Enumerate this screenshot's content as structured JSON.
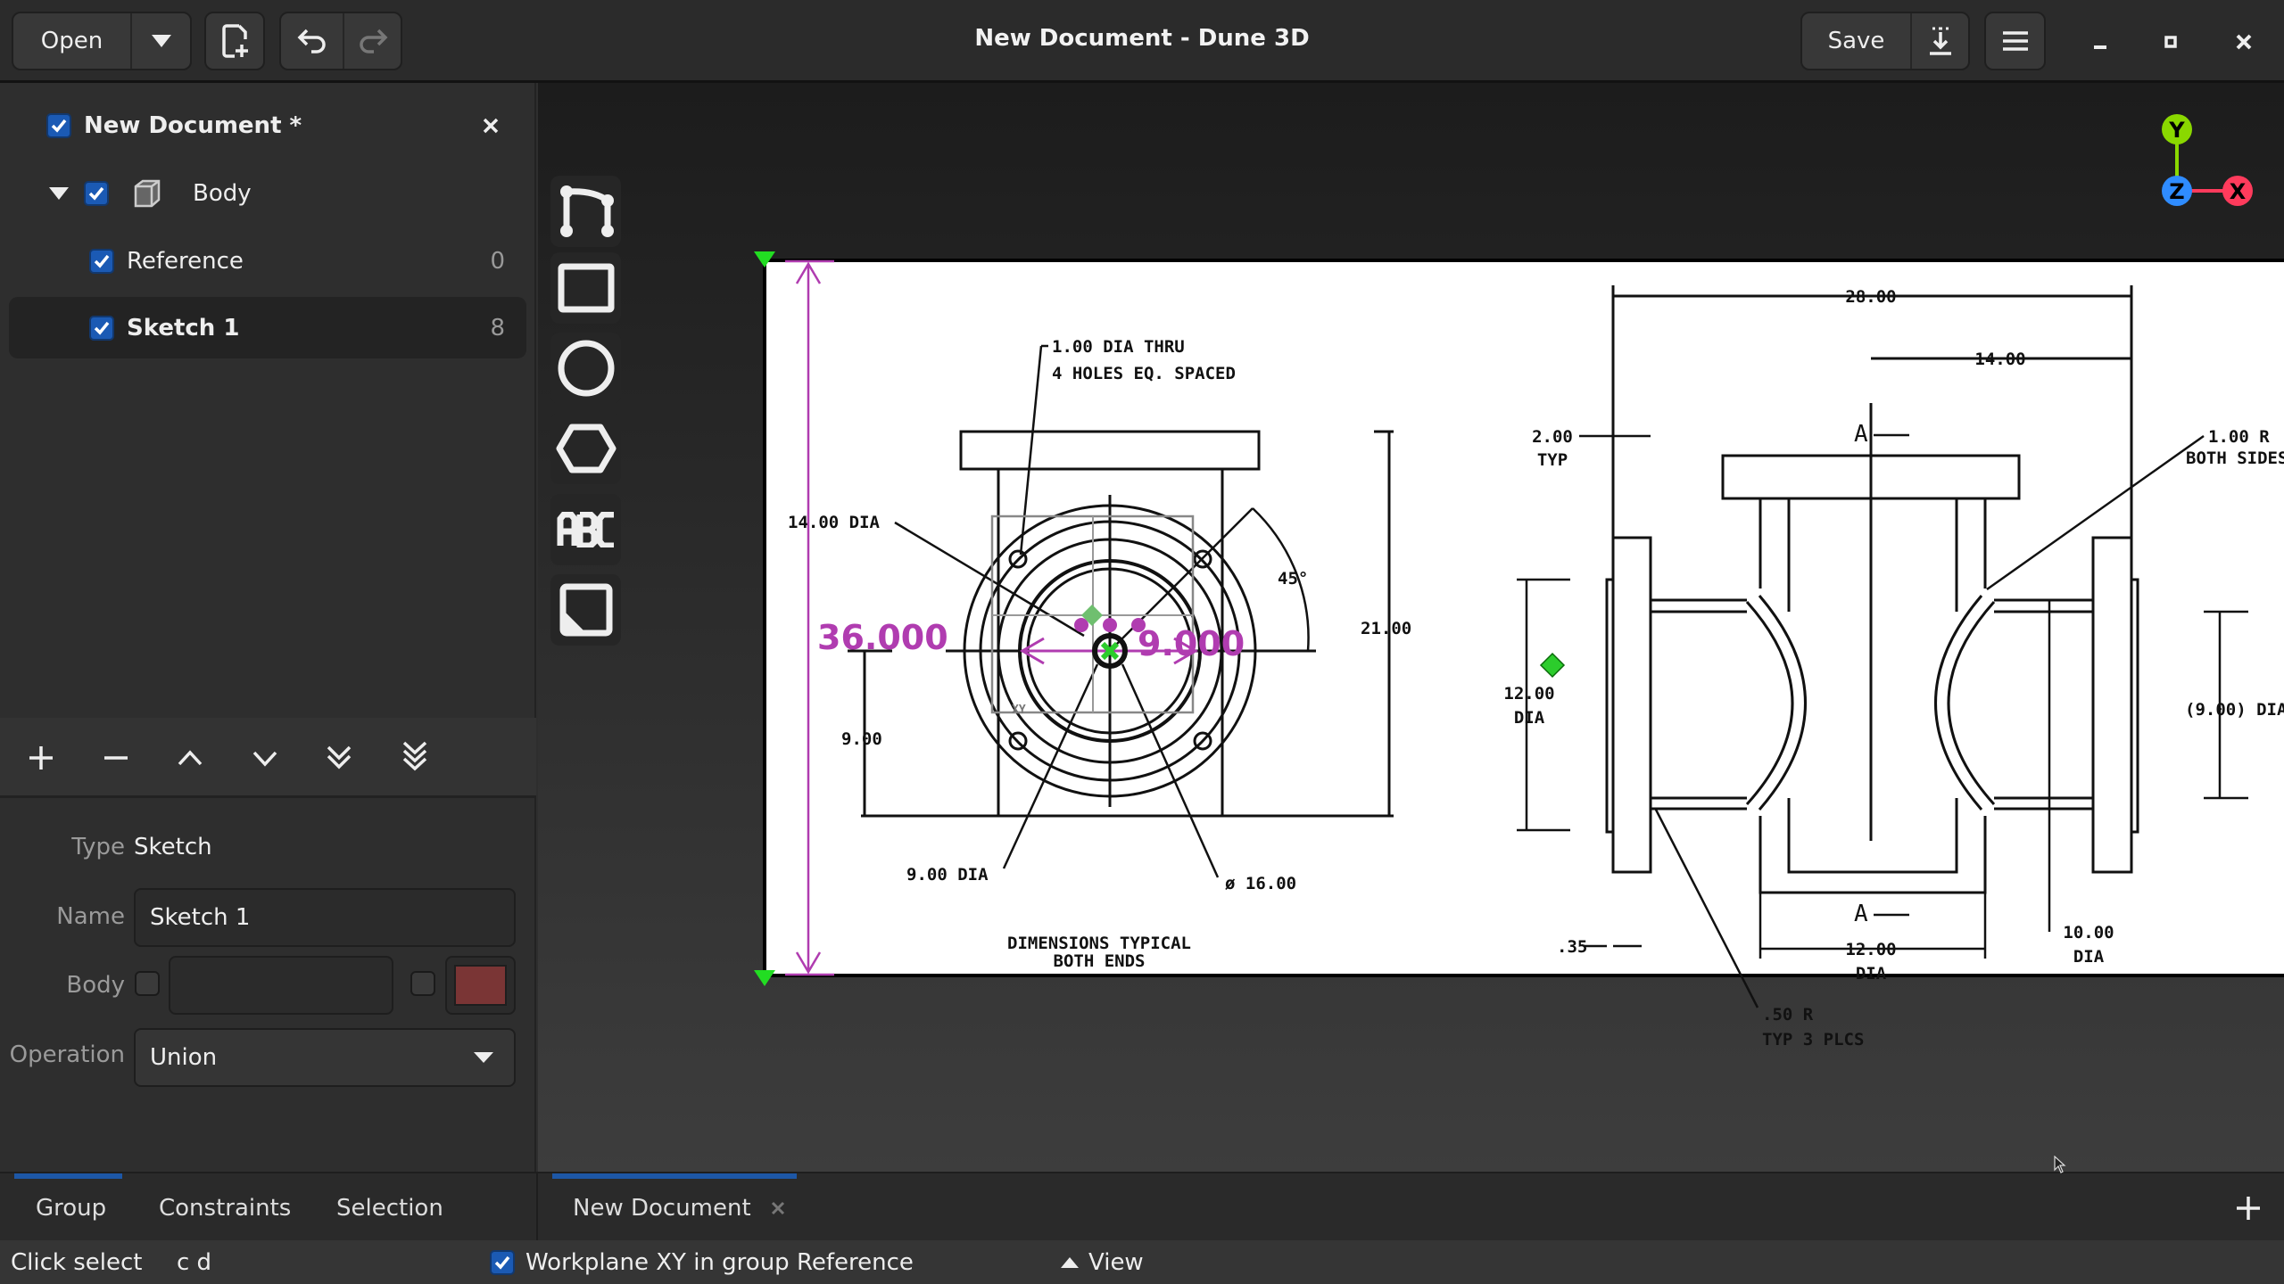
{
  "header": {
    "open_label": "Open",
    "title": "New Document - Dune 3D",
    "save_label": "Save"
  },
  "tree": {
    "document": {
      "label": "New Document *",
      "checked": true
    },
    "items": [
      {
        "label": "Body",
        "count": "",
        "checked": true
      },
      {
        "label": "Reference",
        "count": "0",
        "checked": true
      },
      {
        "label": "Sketch 1",
        "count": "8",
        "checked": true,
        "selected": true
      }
    ]
  },
  "properties": {
    "type_label": "Type",
    "type_value": "Sketch",
    "name_label": "Name",
    "name_value": "Sketch 1",
    "body_label": "Body",
    "body_value": "",
    "body_color": "#7a3535",
    "operation_label": "Operation",
    "operation_value": "Union"
  },
  "tabs": {
    "left": [
      "Group",
      "Constraints",
      "Selection"
    ],
    "document_tab": "New Document"
  },
  "status": {
    "message": "Click select",
    "keys": "c d",
    "workplane_label": "Workplane XY in group Reference",
    "workplane_checked": true,
    "view_label": "View"
  },
  "tools": [
    "draw-contour-icon",
    "rectangle-icon",
    "circle-icon",
    "polygon-icon",
    "text-icon",
    "workplane-icon"
  ],
  "axes": {
    "x": "X",
    "y": "Y",
    "z": "Z",
    "x_color": "#ff3b5c",
    "y_color": "#8ad800",
    "z_color": "#2f8cff"
  },
  "sketch": {
    "constraint_length": "36.000",
    "constraint_diameter": "9.000",
    "color": "#b03cb0"
  },
  "drawing": {
    "front": {
      "holes_line1": "1.00 DIA THRU",
      "holes_line2": "4 HOLES EQ. SPACED",
      "dia14": "14.00 DIA",
      "angle": "45°",
      "height": "21.00",
      "half": "9.00",
      "dia9": "9.00 DIA",
      "dia16": "ø 16.00",
      "note1": "DIMENSIONS TYPICAL",
      "note2": "BOTH ENDS",
      "workplane": "XY"
    },
    "side": {
      "length": "28.00",
      "half_length": "14.00",
      "flange": "2.00",
      "flange2": "TYP",
      "dia12": "12.00",
      "dia12b": "DIA",
      "section": "A",
      "radius1": "1.00 R",
      "radius1b": "BOTH SIDES",
      "bore": "(9.00) DIA",
      "lip": ".35",
      "bottom_dia": "12.00",
      "bottom_dia2": "DIA",
      "dia10": "10.00",
      "dia10b": "DIA",
      "radius2": ".50 R",
      "radius2b": "TYP 3 PLCS"
    }
  }
}
